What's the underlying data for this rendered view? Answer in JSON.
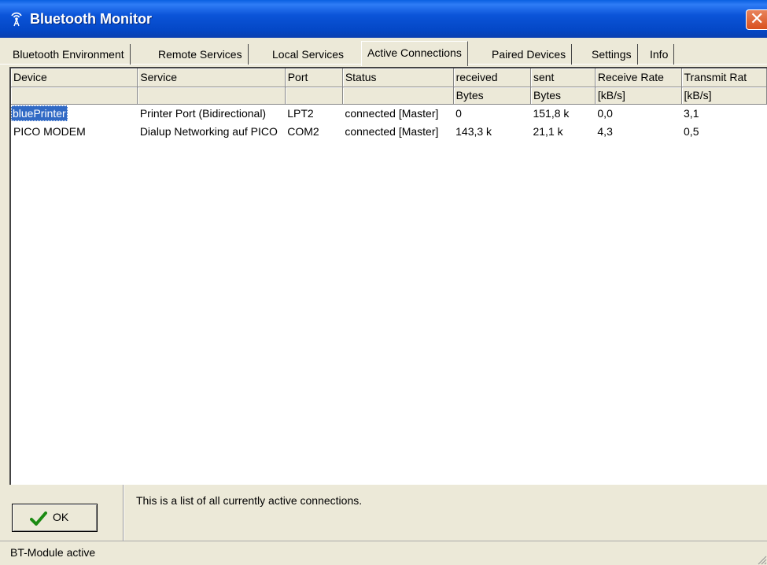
{
  "window": {
    "title": "Bluetooth Monitor",
    "icon": "bluetooth-antenna-icon",
    "close_icon": "close-icon"
  },
  "tabs": [
    {
      "label": "Bluetooth Environment",
      "active": false
    },
    {
      "label": "Remote Services",
      "active": false
    },
    {
      "label": "Local Services",
      "active": false
    },
    {
      "label": "Active Connections",
      "active": true
    },
    {
      "label": "Paired Devices",
      "active": false
    },
    {
      "label": "Settings",
      "active": false
    },
    {
      "label": "Info",
      "active": false
    }
  ],
  "table": {
    "headers": [
      "Device",
      "Service",
      "Port",
      "Status",
      "received",
      "sent",
      "Receive Rate",
      "Transmit Rat"
    ],
    "units": [
      "",
      "",
      "",
      "",
      "Bytes",
      "Bytes",
      "[kB/s]",
      "[kB/s]"
    ],
    "rows": [
      [
        "bluePrinter",
        "Printer Port (Bidirectional)",
        "LPT2",
        "connected [Master]",
        "0",
        "151,8 k",
        "0,0",
        "3,1"
      ],
      [
        "PICO MODEM",
        "Dialup Networking auf PICO",
        "COM2",
        "connected [Master]",
        "143,3 k",
        "21,1 k",
        "4,3",
        "0,5"
      ]
    ],
    "selected_row": 0
  },
  "ok_button": {
    "label": "OK",
    "icon": "checkmark-icon"
  },
  "info_text": "This is a list of all currently active connections.",
  "status_bar": {
    "text": "BT-Module active"
  },
  "colors": {
    "titlebar": "#0a54d8",
    "selection": "#316ac5",
    "face": "#ece9d8"
  }
}
